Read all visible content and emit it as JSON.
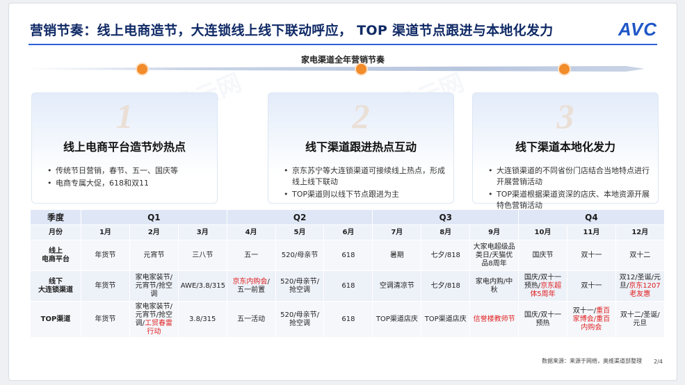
{
  "title": "营销节奏：线上电商造节，大连锁线上线下联动呼应， TOP 渠道节点跟进与本地化发力",
  "logo": "AVC",
  "watermark_text": "奥维云网",
  "timeline_title": "家电渠道全年营销节奏",
  "colors": {
    "accent": "#2b5fd9",
    "dot": "#f28b2a",
    "highlight": "#e02020"
  },
  "cards": [
    {
      "num": "1",
      "heading": "线上电商平台造节炒热点",
      "bullets": [
        "传统节日营销，春节、五一、国庆等",
        "电商专属大促，618和双11"
      ]
    },
    {
      "num": "2",
      "heading": "线下渠道跟进热点互动",
      "bullets": [
        "京东苏宁等大连锁渠道可接续线上热点，形成线上线下联动",
        "TOP渠道则以线下节点跟进为主"
      ]
    },
    {
      "num": "3",
      "heading": "线下渠道本地化发力",
      "bullets": [
        "大连锁渠道的不同省份门店结合当地特点进行开展营销活动",
        "TOP渠道根据渠道资深的店庆、本地资源开展特色营销活动"
      ]
    }
  ],
  "table": {
    "quarter_label": "季度",
    "quarters": [
      "Q1",
      "Q2",
      "Q3",
      "Q4"
    ],
    "month_label": "月份",
    "months": [
      "1月",
      "2月",
      "3月",
      "4月",
      "5月",
      "6月",
      "7月",
      "8月",
      "9月",
      "10月",
      "11月",
      "12月"
    ],
    "rows": [
      {
        "label": "线上\n电商平台",
        "cells": [
          [
            {
              "t": "年货节"
            }
          ],
          [
            {
              "t": "元宵节"
            }
          ],
          [
            {
              "t": "三八节"
            }
          ],
          [
            {
              "t": "五一"
            }
          ],
          [
            {
              "t": "520/母亲节"
            }
          ],
          [
            {
              "t": "618"
            }
          ],
          [
            {
              "t": "暑期"
            }
          ],
          [
            {
              "t": "七夕/818"
            }
          ],
          [
            {
              "t": "大家电超级品类日/天猫优品8周年"
            }
          ],
          [
            {
              "t": "国庆节"
            }
          ],
          [
            {
              "t": "双十一"
            }
          ],
          [
            {
              "t": "双十二"
            }
          ]
        ]
      },
      {
        "label": "线下\n大连锁渠道",
        "cells": [
          [
            {
              "t": "年货节"
            }
          ],
          [
            {
              "t": "家电家装节/元宵节/抢空调"
            }
          ],
          [
            {
              "t": "AWE/3.8/315"
            }
          ],
          [
            {
              "t": "京东内购会",
              "hl": true
            },
            {
              "t": "/五一前置"
            }
          ],
          [
            {
              "t": "520/母亲节/抢空调"
            }
          ],
          [
            {
              "t": "618"
            }
          ],
          [
            {
              "t": "空调清凉节"
            }
          ],
          [
            {
              "t": "七夕/818"
            }
          ],
          [
            {
              "t": "家电内购/中秋"
            }
          ],
          [
            {
              "t": "国庆/双十一预热/"
            },
            {
              "t": "京东超体5周年",
              "hl": true
            }
          ],
          [
            {
              "t": "双十一"
            }
          ],
          [
            {
              "t": "双12/圣诞/元旦/"
            },
            {
              "t": "京东1207老友惠",
              "hl": true
            }
          ]
        ]
      },
      {
        "label": "TOP渠道",
        "cells": [
          [
            {
              "t": "年货节"
            }
          ],
          [
            {
              "t": "家电家装节/元宵节/抢空调/"
            },
            {
              "t": "工贸春雷行动",
              "hl": true
            }
          ],
          [
            {
              "t": "3.8/315"
            }
          ],
          [
            {
              "t": "五一活动"
            }
          ],
          [
            {
              "t": "520/母亲节/抢空调"
            }
          ],
          [
            {
              "t": "618"
            }
          ],
          [
            {
              "t": "TOP渠道店庆"
            }
          ],
          [
            {
              "t": "TOP渠道店庆"
            }
          ],
          [
            {
              "t": "信誉楼教师节",
              "hl": true
            }
          ],
          [
            {
              "t": "国庆/双十一预热"
            }
          ],
          [
            {
              "t": "双十一/"
            },
            {
              "t": "重百家博会/重百内购会",
              "hl": true
            }
          ],
          [
            {
              "t": "双十二/圣诞/元旦"
            }
          ]
        ]
      }
    ]
  },
  "footer": "数据来源：来源于网络，奥维渠道部整理",
  "page": "2/4"
}
